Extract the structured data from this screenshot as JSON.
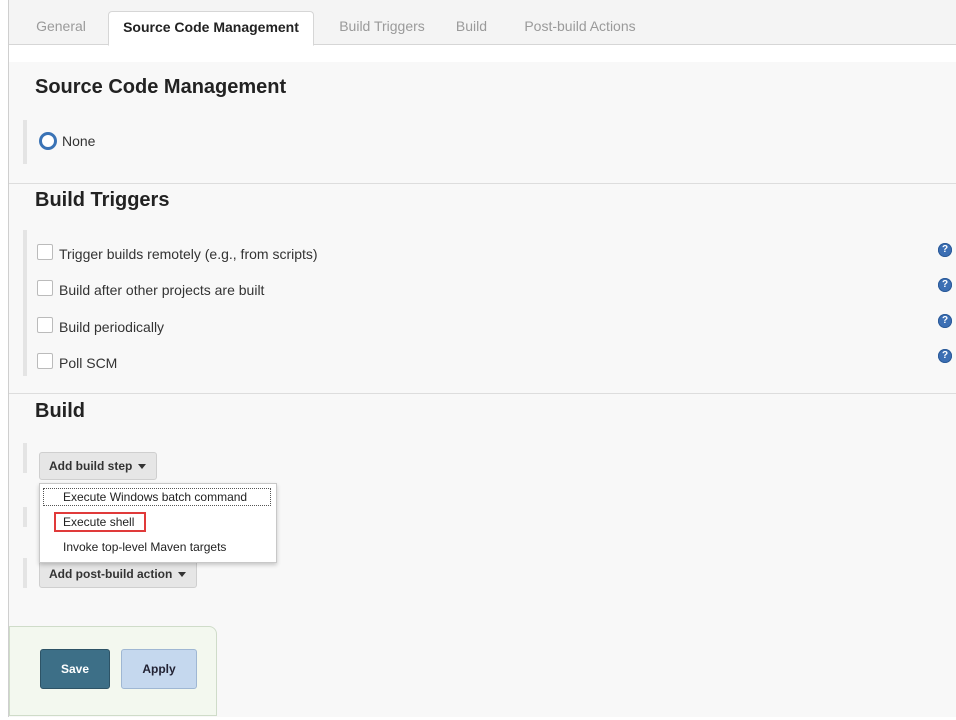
{
  "tabs": [
    {
      "label": "General",
      "active": false
    },
    {
      "label": "Source Code Management",
      "active": true
    },
    {
      "label": "Build Triggers",
      "active": false
    },
    {
      "label": "Build",
      "active": false
    },
    {
      "label": "Post-build Actions",
      "active": false
    }
  ],
  "scm": {
    "title": "Source Code Management",
    "option_none": "None",
    "selected": "None"
  },
  "triggers": {
    "title": "Build Triggers",
    "items": [
      {
        "label": "Trigger builds remotely (e.g., from scripts)",
        "checked": false
      },
      {
        "label": "Build after other projects are built",
        "checked": false
      },
      {
        "label": "Build periodically",
        "checked": false
      },
      {
        "label": "Poll SCM",
        "checked": false
      }
    ],
    "help_glyph": "?"
  },
  "build": {
    "title": "Build",
    "add_step_label": "Add build step",
    "menu": [
      {
        "label": "Execute Windows batch command",
        "state": "focused"
      },
      {
        "label": "Execute shell",
        "state": "highlighted"
      },
      {
        "label": "Invoke top-level Maven targets",
        "state": "normal"
      }
    ]
  },
  "post_build": {
    "add_action_label": "Add post-build action"
  },
  "footer": {
    "save_label": "Save",
    "apply_label": "Apply"
  },
  "colors": {
    "accent_blue": "#3a73b6",
    "save_button": "#3d6f87",
    "apply_button": "#c5d8ee",
    "highlight_border": "#e03a3a"
  },
  "icons": [
    "radio-selected-icon",
    "checkbox-icon",
    "help-icon",
    "caret-down-icon"
  ]
}
